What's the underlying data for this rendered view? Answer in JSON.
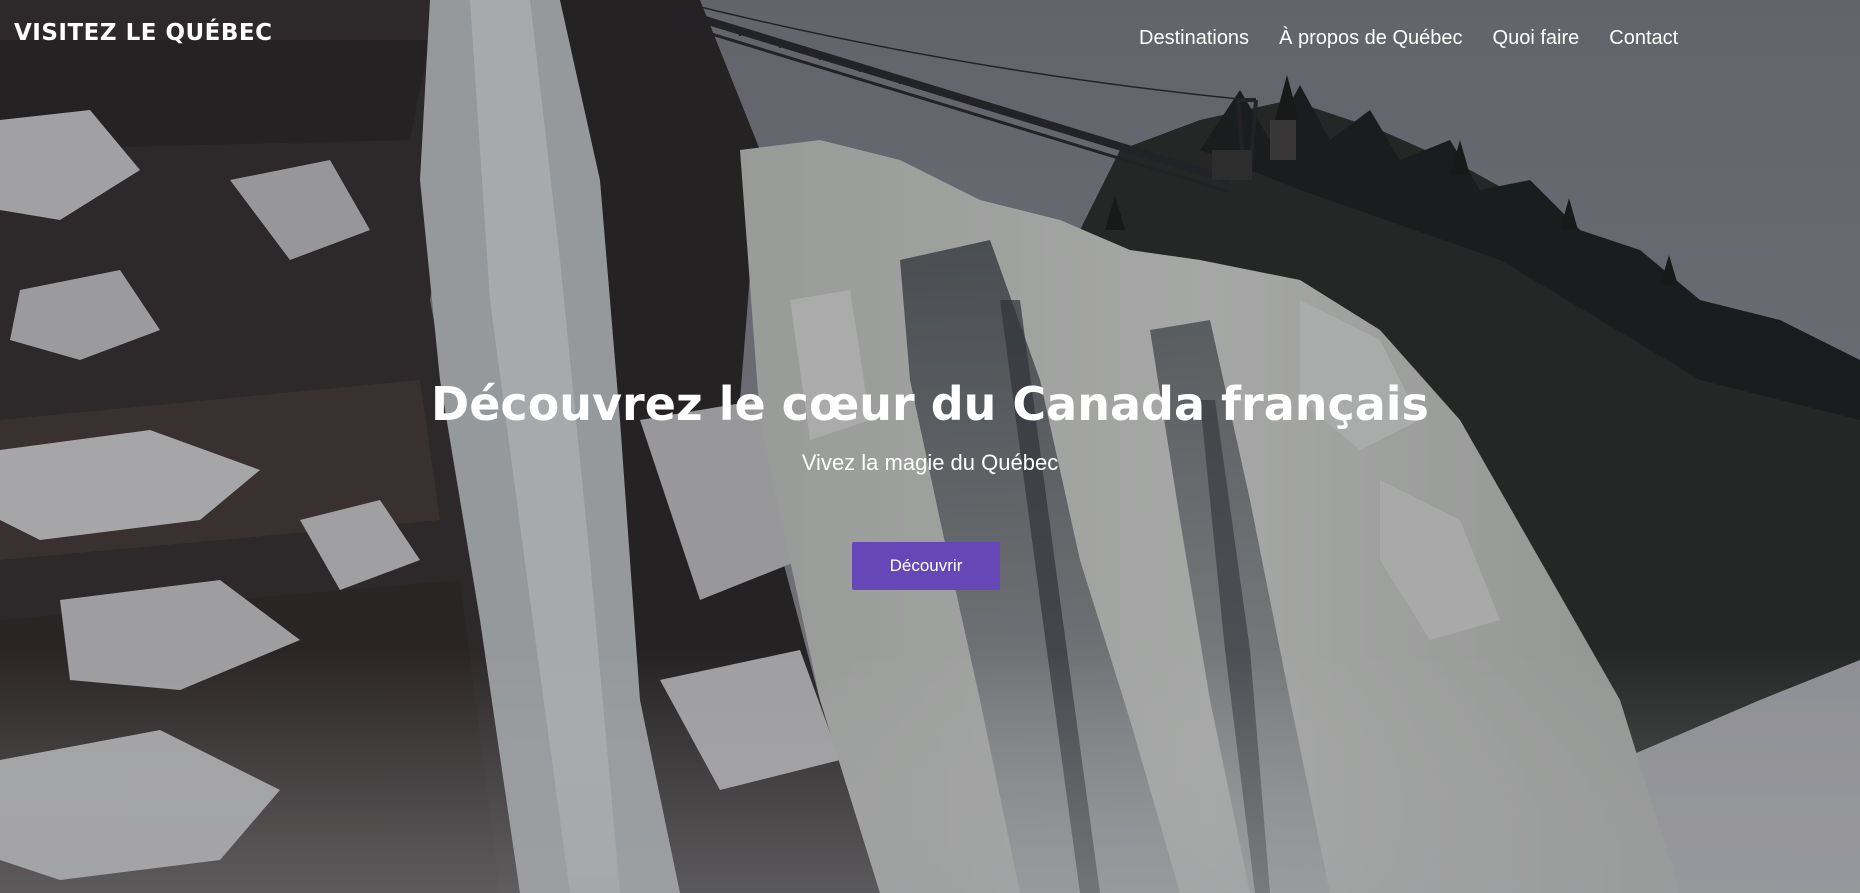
{
  "header": {
    "brand": "VISITEZ LE QUÉBEC",
    "nav": [
      {
        "label": "Destinations"
      },
      {
        "label": "À propos de Québec"
      },
      {
        "label": "Quoi faire"
      },
      {
        "label": "Contact"
      }
    ]
  },
  "hero": {
    "title": "Découvrez le cœur du Canada français",
    "subtitle": "Vivez la magie du Québec",
    "cta_label": "Découvrir"
  },
  "colors": {
    "cta_background": "#6647b8",
    "text": "#ffffff",
    "sky": "#8c8d94"
  }
}
